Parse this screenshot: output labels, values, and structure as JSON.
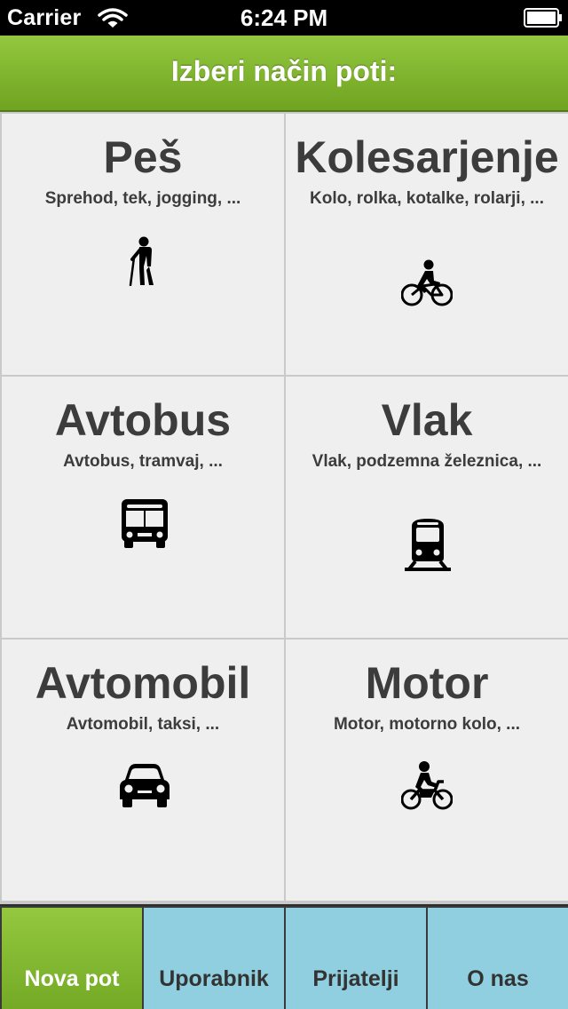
{
  "status_bar": {
    "carrier": "Carrier",
    "time": "6:24 PM",
    "wifi_icon": "wifi-icon",
    "battery_icon": "battery-icon"
  },
  "header": {
    "title": "Izberi način poti:",
    "color": "#82b82e"
  },
  "modes": [
    {
      "title": "Peš",
      "subtitle": "Sprehod, tek, jogging, ...",
      "icon": "walking-person-icon"
    },
    {
      "title": "Kolesarjenje",
      "subtitle": "Kolo, rolka, kotalke, rolarji, ...",
      "icon": "bicycle-icon"
    },
    {
      "title": "Avtobus",
      "subtitle": "Avtobus, tramvaj, ...",
      "icon": "bus-icon"
    },
    {
      "title": "Vlak",
      "subtitle": "Vlak, podzemna železnica, ...",
      "icon": "train-icon"
    },
    {
      "title": "Avtomobil",
      "subtitle": "Avtomobil, taksi, ...",
      "icon": "car-icon"
    },
    {
      "title": "Motor",
      "subtitle": "Motor, motorno kolo, ...",
      "icon": "motorcycle-icon"
    }
  ],
  "tabbar": {
    "tabs": [
      {
        "label": "Nova pot",
        "active": true
      },
      {
        "label": "Uporabnik",
        "active": false
      },
      {
        "label": "Prijatelji",
        "active": false
      },
      {
        "label": "O nas",
        "active": false
      }
    ],
    "active_color": "#82b82e",
    "inactive_color": "#8fcfe0"
  }
}
